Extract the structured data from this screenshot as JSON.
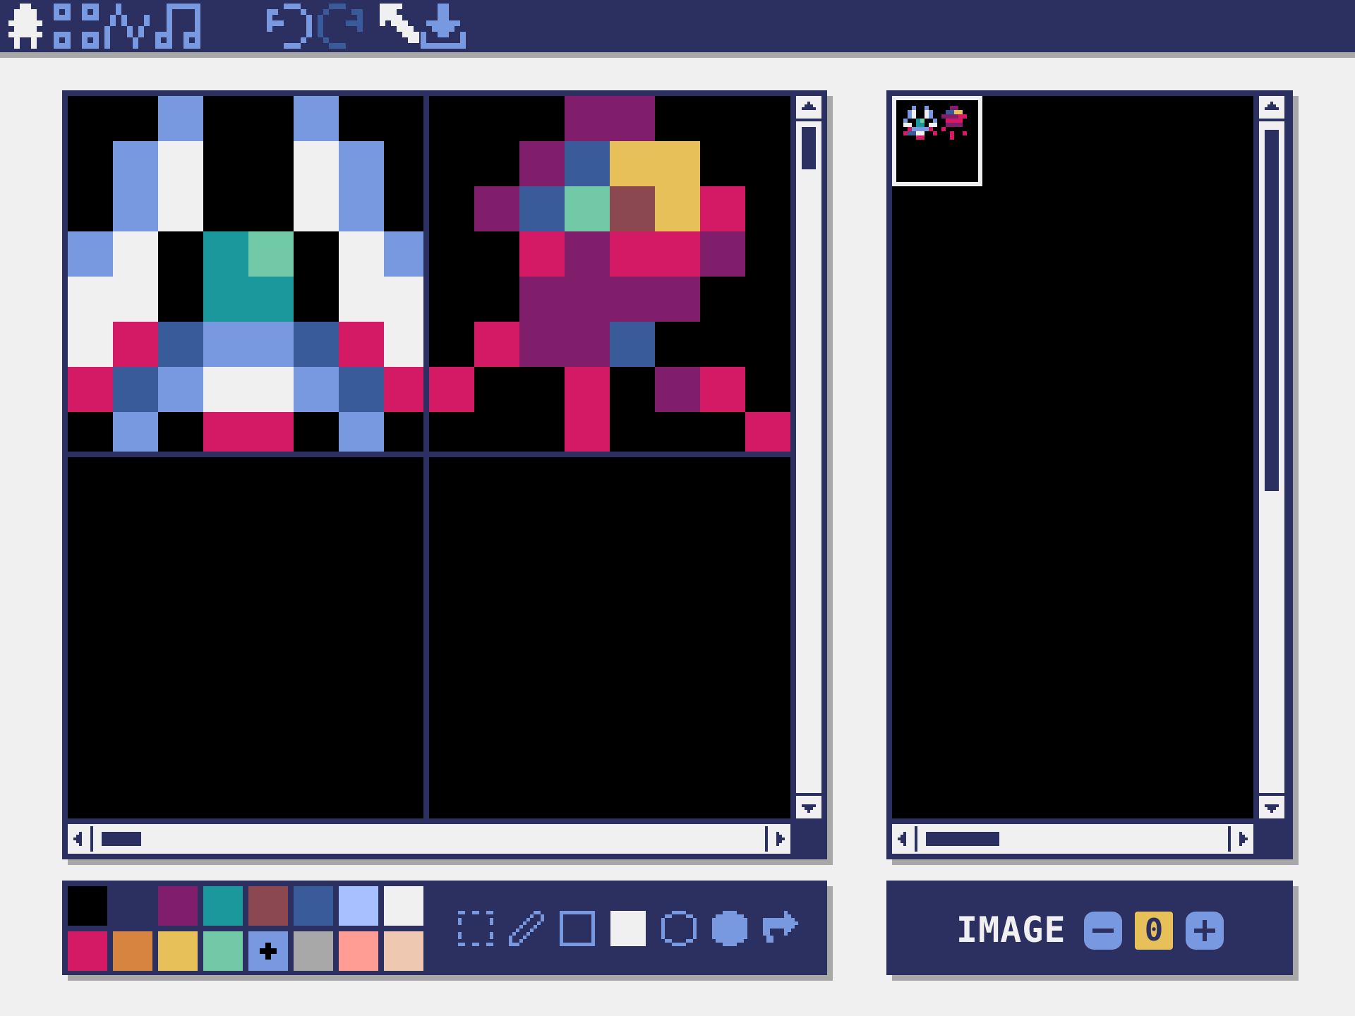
{
  "toolbar": {
    "left_icons": [
      "character-icon",
      "grid-icon",
      "wave-icon",
      "music-note-icon"
    ],
    "undo_icon": "undo-icon",
    "redo_icon": "redo-icon",
    "select_icon": "pointer-icon",
    "save_icon": "download-icon"
  },
  "colors": {
    "navy": "#2c3060",
    "panel_light": "#f0f0f0",
    "shadow": "#a8a8a8",
    "accent_blue": "#7898e0",
    "accent_yellow": "#e8c05a"
  },
  "palette": [
    "#000000",
    "#2c3060",
    "#801e6c",
    "#1a989c",
    "#8c4850",
    "#3a5b9a",
    "#a8c0ff",
    "#f0f0f0",
    "#d41a64",
    "#d68440",
    "#e8c05a",
    "#72c9a8",
    "#7898e0",
    "#a8a8a8",
    "#ff9c94",
    "#eec8b0"
  ],
  "palette_selected_index": 12,
  "tools": [
    "select-rect-icon",
    "pencil-icon",
    "rectangle-outline-icon",
    "rectangle-fill-icon",
    "circle-outline-icon",
    "circle-fill-icon",
    "fill-bucket-icon"
  ],
  "sprite_panel": {
    "label": "IMAGE",
    "frame": "0",
    "minus_icon": "minus-icon",
    "plus_icon": "plus-icon"
  }
}
